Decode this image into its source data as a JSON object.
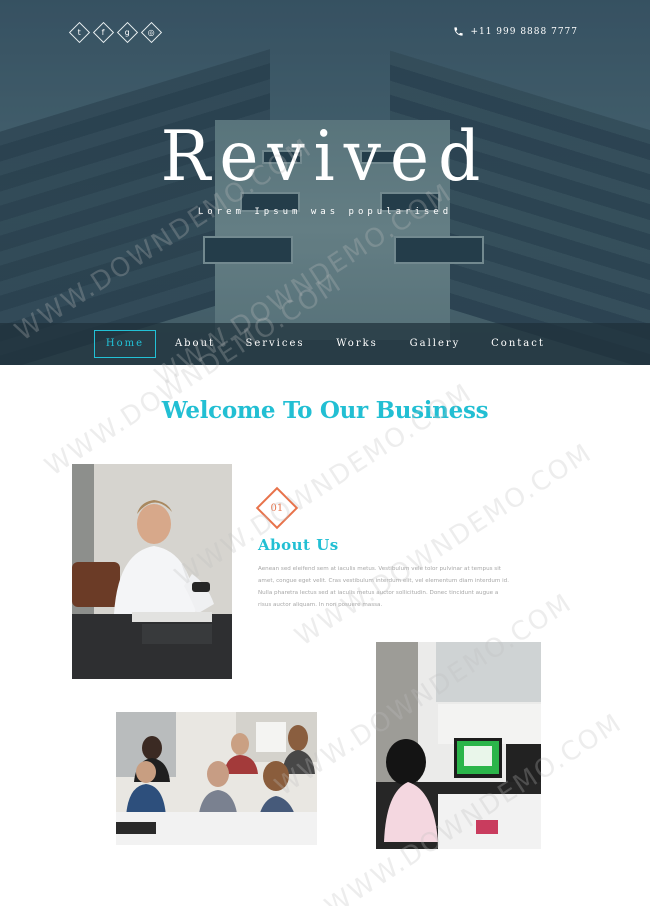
{
  "header": {
    "socials": [
      {
        "icon": "twitter-icon",
        "glyph": "t"
      },
      {
        "icon": "facebook-icon",
        "glyph": "f"
      },
      {
        "icon": "google-plus-icon",
        "glyph": "g"
      },
      {
        "icon": "dribbble-icon",
        "glyph": "◎"
      }
    ],
    "phone": "+11 999 8888 7777",
    "phone_icon": "phone-icon"
  },
  "hero": {
    "title": "Revived",
    "tagline": "Lorem Ipsum was popularised"
  },
  "nav": {
    "items": [
      {
        "label": "Home",
        "active": true
      },
      {
        "label": "About",
        "active": false
      },
      {
        "label": "Services",
        "active": false
      },
      {
        "label": "Works",
        "active": false
      },
      {
        "label": "Gallery",
        "active": false
      },
      {
        "label": "Contact",
        "active": false
      }
    ]
  },
  "welcome": {
    "title": "Welcome To Our Business"
  },
  "about": {
    "number": "01",
    "title": "About Us",
    "text": "Aenean sed eleifend sem at iaculis metus. Vestibulum vele tolor pulvinar at tempus sit amet, congue eget velit. Cras vestibulum interdum elit, vel elementum diam interdum id. Nulla pharetra lectus sed at iaculis metus auctor sollicitudin. Donec tincidunt augue a risus auctor aliquam. In non posuere massa."
  },
  "watermark": "WWW.DOWNDEMO.COM",
  "colors": {
    "accent": "#22bfd3",
    "badge": "#e8734b",
    "nav_bg": "#1e303a"
  }
}
